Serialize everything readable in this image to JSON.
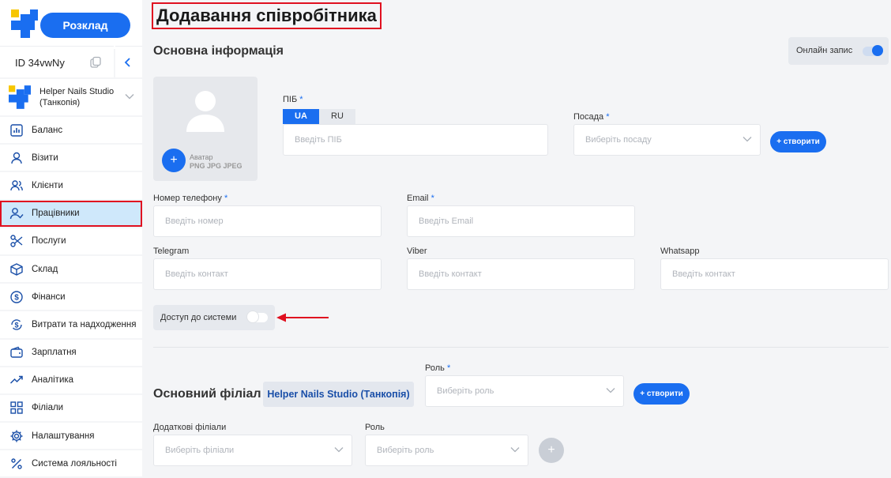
{
  "sidebar": {
    "schedule_button": "Розклад",
    "id_label": "ID 34vwNy",
    "studio_name": "Helper Nails Studio (Танкопія)",
    "items": [
      {
        "label": "Баланс",
        "icon": "chart-icon"
      },
      {
        "label": "Візити",
        "icon": "user-icon"
      },
      {
        "label": "Клієнти",
        "icon": "users-icon"
      },
      {
        "label": "Працівники",
        "icon": "user-check-icon",
        "active": true
      },
      {
        "label": "Послуги",
        "icon": "scissors-icon"
      },
      {
        "label": "Склад",
        "icon": "box-icon"
      },
      {
        "label": "Фінанси",
        "icon": "dollar-icon"
      },
      {
        "label": "Витрати та надходження",
        "icon": "dollar-exchange-icon"
      },
      {
        "label": "Зарплатня",
        "icon": "wallet-icon"
      },
      {
        "label": "Аналітика",
        "icon": "trend-icon"
      },
      {
        "label": "Філіали",
        "icon": "grid-icon"
      },
      {
        "label": "Налаштування",
        "icon": "gear-icon"
      },
      {
        "label": "Система лояльності",
        "icon": "percent-icon"
      }
    ]
  },
  "page": {
    "title": "Додавання співробітника",
    "basic_info_title": "Основна інформація",
    "online_booking_label": "Онлайн запис",
    "online_booking_on": true
  },
  "avatar": {
    "add_symbol": "+",
    "label": "Аватар",
    "formats": "PNG JPG JPEG"
  },
  "form": {
    "name_label": "ПІБ",
    "name_tabs": [
      "UA",
      "RU"
    ],
    "name_placeholder": "Введіть ПІБ",
    "position_label": "Посада",
    "position_placeholder": "Виберіть посаду",
    "create_button": "+ створити",
    "phone_label": "Номер телефону",
    "phone_placeholder": "Введіть номер",
    "email_label": "Email",
    "email_placeholder": "Введіть Email",
    "telegram_label": "Telegram",
    "viber_label": "Viber",
    "whatsapp_label": "Whatsapp",
    "contact_placeholder": "Введіть контакт",
    "required_mark": "*",
    "system_access_label": "Доступ до системи",
    "system_access_on": false
  },
  "branch": {
    "main_branch_title": "Основний філіал",
    "main_branch_value": "Helper Nails Studio (Танкопія)",
    "role_label": "Роль",
    "role_placeholder": "Виберіть роль",
    "extra_branches_label": "Додаткові філіали",
    "extra_branches_placeholder": "Виберіть філіали",
    "add_symbol": "+"
  },
  "colors": {
    "accent": "#1a6ef0",
    "highlight_border": "#e01020",
    "active_bg": "#cfe8fb"
  }
}
